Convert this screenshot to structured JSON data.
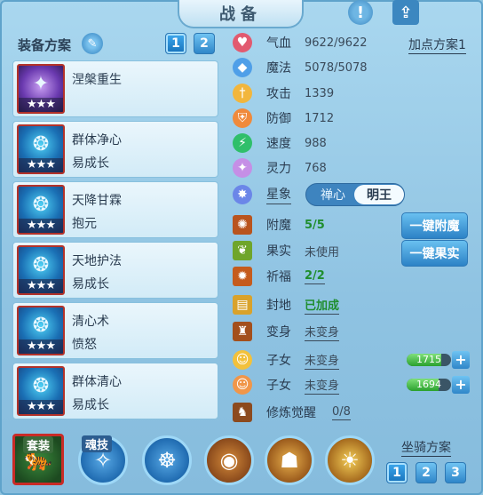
{
  "header": {
    "title": "战备"
  },
  "left_panel": {
    "title": "装备方案",
    "tabs": [
      "1",
      "2"
    ],
    "skills": [
      {
        "name": "涅槃重生",
        "sub": "",
        "stars": "★★★",
        "glyph": "✦"
      },
      {
        "name": "群体净心",
        "sub": "易成长",
        "stars": "★★★",
        "glyph": "❂"
      },
      {
        "name": "天降甘霖",
        "sub": "抱元",
        "stars": "★★★",
        "glyph": "❂"
      },
      {
        "name": "天地护法",
        "sub": "易成长",
        "stars": "★★★",
        "glyph": "❂"
      },
      {
        "name": "清心术",
        "sub": "愤怒",
        "stars": "★★★",
        "glyph": "❂"
      },
      {
        "name": "群体清心",
        "sub": "易成长",
        "stars": "★★★",
        "glyph": "❂"
      }
    ]
  },
  "stats": {
    "plan_link": "加点方案1",
    "hp": {
      "label": "气血",
      "value": "9622/9622"
    },
    "mp": {
      "label": "魔法",
      "value": "5078/5078"
    },
    "atk": {
      "label": "攻击",
      "value": "1339"
    },
    "def": {
      "label": "防御",
      "value": "1712"
    },
    "spd": {
      "label": "速度",
      "value": "988"
    },
    "spi": {
      "label": "灵力",
      "value": "768"
    },
    "star": {
      "label": "星象",
      "options": [
        "禅心",
        "明王"
      ]
    },
    "enchant": {
      "label": "附魔",
      "value": "5/5",
      "button": "一键附魔"
    },
    "fruit": {
      "label": "果实",
      "value": "未使用",
      "button": "一键果实"
    },
    "bless": {
      "label": "祈福",
      "value": "2/2"
    },
    "seal": {
      "label": "封地",
      "value": "已加成"
    },
    "transform": {
      "label": "变身",
      "value": "未变身"
    },
    "child1": {
      "label": "子女",
      "value": "未变身",
      "bar": "1715",
      "bar_level": 0.78
    },
    "child2": {
      "label": "子女",
      "value": "未变身",
      "bar": "1694",
      "bar_level": 0.72
    },
    "awaken": {
      "label": "修炼觉醒",
      "value": "0/8"
    }
  },
  "bottom": {
    "outfit_label": "套装",
    "soul_label": "魂技",
    "mount_label": "坐骑方案",
    "mount_tabs": [
      "1",
      "2",
      "3"
    ]
  },
  "colors": {
    "accent": "#2f86c9",
    "green": "#1f8e2e",
    "frame": "#5fa3cb"
  }
}
